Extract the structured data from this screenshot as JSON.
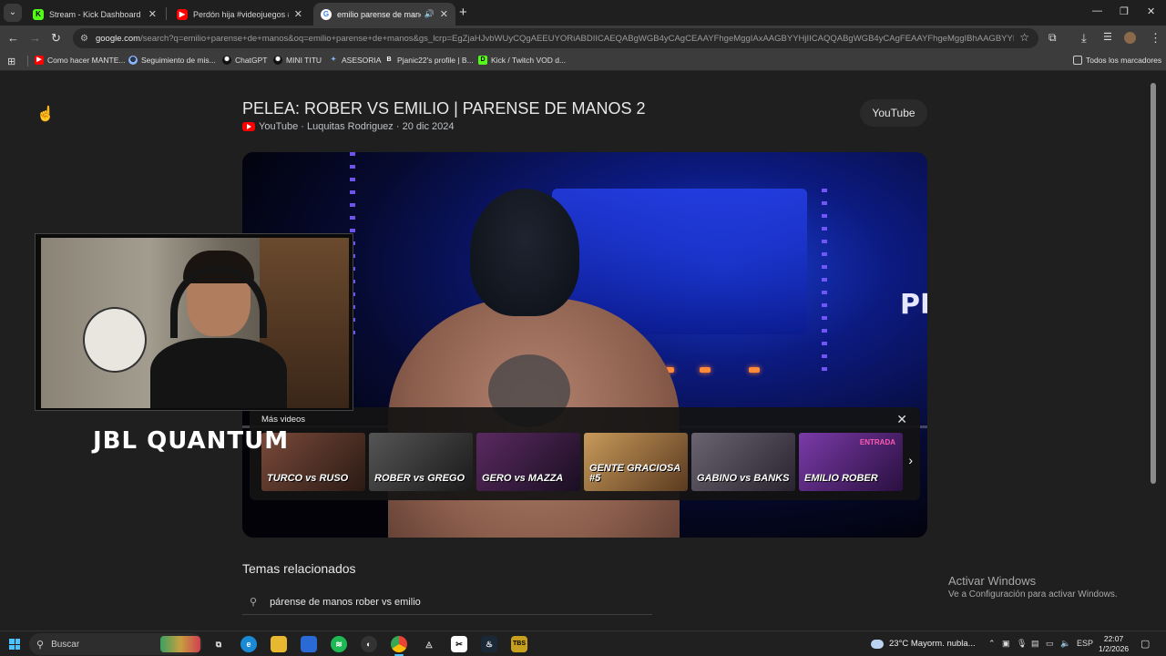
{
  "browser": {
    "tabs": [
      {
        "title": "Stream - Kick Dashboard",
        "favicon": "kick-icon",
        "color": "#53fc18"
      },
      {
        "title": "Perdón hija #videojuegos #hum",
        "favicon": "youtube-icon",
        "color": "#ff0000"
      },
      {
        "title": "emilio parense de manos -",
        "favicon": "google-icon",
        "color": "#ffffff",
        "active": true
      }
    ],
    "url_host": "google.com",
    "url_rest": "/search?q=emilio+parense+de+manos&oq=emilio+parense+de+manos&gs_lcrp=EgZjaHJvbWUyCQgAEEUYORiABDIICAEQABgWGB4yCAgCEAAYFhgeMggIAxAAGBYYHjIICAQQABgWGB4yCAgFEAAYFhgeMggIBhAAGBYYHjIICAcQA..."
  },
  "bookmarks": [
    {
      "label": "Como hacer MANTE...",
      "icon": "youtube-icon",
      "color": "#ff0000"
    },
    {
      "label": "Seguimiento de mis...",
      "icon": "globe-icon",
      "color": "#8ab4f8"
    },
    {
      "label": "ChatGPT",
      "icon": "chatgpt-icon",
      "color": "#1a1a1a"
    },
    {
      "label": "MINI TITU",
      "icon": "chatgpt-icon",
      "color": "#1a1a1a"
    },
    {
      "label": "ASESORIA",
      "icon": "sparkle-icon",
      "color": "#8ab4f8"
    },
    {
      "label": "Pjanic22's profile | B...",
      "icon": "b-icon",
      "color": "#333333"
    },
    {
      "label": "Kick / Twitch VOD d...",
      "icon": "d-icon",
      "color": "#53fc18"
    }
  ],
  "bookmarks_all": "Todos los marcadores",
  "video": {
    "title": "PELEA: ROBER VS EMILIO | PARENSE DE MANOS 2",
    "source": "YouTube",
    "channel": "Luquitas Rodriguez",
    "date": "20 dic 2024",
    "button": "YouTube",
    "more_videos_label": "Más videos",
    "thumbnails": [
      {
        "text": "TURCO vs RUSO",
        "bg": "#5a3a2a"
      },
      {
        "text": "ROBER vs GREGO",
        "bg": "#3a3a3a"
      },
      {
        "text": "GERO vs MAZZA",
        "bg": "#3a2040"
      },
      {
        "text": "GENTE GRACIOSA #5",
        "bg": "#6a4a2a"
      },
      {
        "text": "GABINO vs BANKS",
        "bg": "#3a3440"
      },
      {
        "text": "EMILIO ROBER",
        "tag": "ENTRADA",
        "bg": "#4a2a6a"
      }
    ]
  },
  "overlay": {
    "brand": "JBL QUANTUM"
  },
  "related": {
    "title": "Temas relacionados",
    "items": [
      "párense de manos rober vs emilio"
    ]
  },
  "activate_windows": {
    "line1": "Activar Windows",
    "line2": "Ve a Configuración para activar Windows."
  },
  "taskbar": {
    "search": "Buscar",
    "weather": "23°C  Mayorm. nubla...",
    "lang": "ESP",
    "time": "22:07",
    "date": "1/2/2026"
  }
}
